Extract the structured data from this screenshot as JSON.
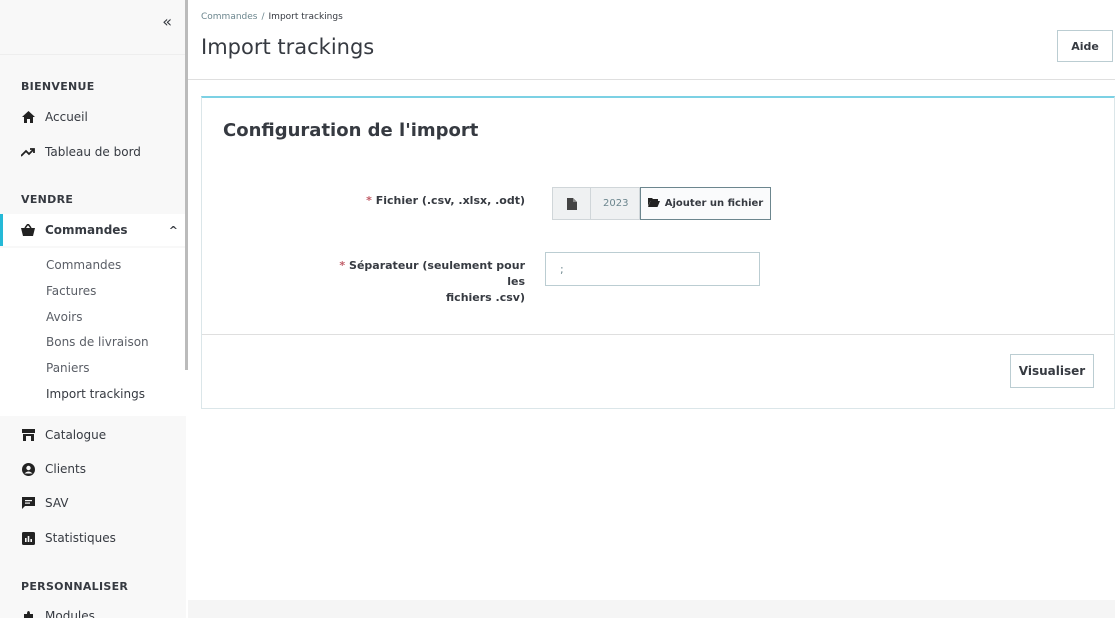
{
  "sidebar": {
    "collapse_label": "«",
    "sections": {
      "welcome": "BIENVENUE",
      "sell": "VENDRE",
      "customize": "PERSONNALISER"
    },
    "items": {
      "home": "Accueil",
      "dashboard": "Tableau de bord",
      "orders": "Commandes",
      "catalog": "Catalogue",
      "clients": "Clients",
      "sav": "SAV",
      "stats": "Statistiques",
      "modules": "Modules"
    },
    "orders_caret": "^",
    "submenu": [
      "Commandes",
      "Factures",
      "Avoirs",
      "Bons de livraison",
      "Paniers",
      "Import trackings"
    ]
  },
  "header": {
    "breadcrumb_parent": "Commandes",
    "breadcrumb_sep": "/",
    "breadcrumb_current": "Import trackings",
    "title": "Import trackings",
    "help_label": "Aide"
  },
  "card": {
    "title": "Configuration de l'import",
    "required_mark": "*",
    "file_label": "Fichier (.csv, .xlsx, .odt)",
    "file_name": "2023",
    "add_file_label": "Ajouter un fichier",
    "separator_label_line1": "Séparateur (seulement pour les",
    "separator_label_line2": "fichiers .csv)",
    "separator_value": ";",
    "preview_label": "Visualiser"
  },
  "colors": {
    "accent": "#25b9d7",
    "required": "#c05c67"
  }
}
